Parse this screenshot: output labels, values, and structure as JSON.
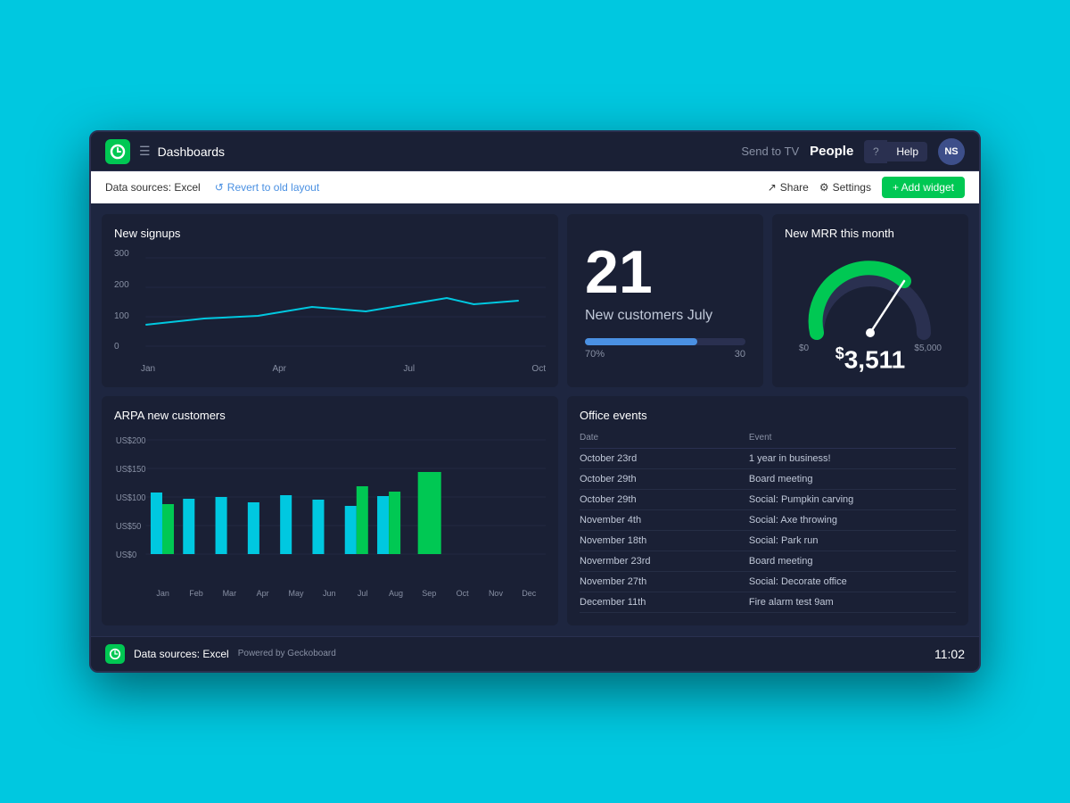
{
  "navbar": {
    "logo_alt": "Geckoboard logo",
    "menu_icon": "☰",
    "title": "Dashboards",
    "send_to_tv": "Send to TV",
    "people": "People",
    "help_q": "?",
    "help_label": "Help",
    "avatar": "NS"
  },
  "subnav": {
    "data_sources": "Data sources: Excel",
    "revert_label": "Revert to old layout",
    "revert_icon": "↺",
    "share_label": "Share",
    "share_icon": "↗",
    "settings_label": "Settings",
    "settings_icon": "⚙",
    "add_widget_label": "+ Add widget"
  },
  "signups_widget": {
    "title": "New signups",
    "y_labels": [
      "300",
      "200",
      "100",
      "0"
    ],
    "x_labels": [
      "Jan",
      "Apr",
      "Jul",
      "Oct"
    ]
  },
  "customers_widget": {
    "number": "21",
    "label": "New customers July",
    "progress_pct": "70%",
    "progress_max": "30"
  },
  "mrr_widget": {
    "title": "New MRR this month",
    "label_left": "$0",
    "label_right": "$5,000",
    "value_prefix": "$",
    "value": "3,511"
  },
  "arpa_widget": {
    "title": "ARPA new customers",
    "y_labels": [
      "US$200",
      "US$150",
      "US$100",
      "US$50",
      "US$0"
    ],
    "x_labels": [
      "Jan",
      "Feb",
      "Mar",
      "Apr",
      "May",
      "Jun",
      "Jul",
      "Aug",
      "Sep",
      "Oct",
      "Nov",
      "Dec"
    ],
    "bars": [
      {
        "month": "Jan",
        "cyan": 110,
        "green": 90
      },
      {
        "month": "Feb",
        "cyan": 95,
        "green": 0
      },
      {
        "month": "Mar",
        "cyan": 100,
        "green": 0
      },
      {
        "month": "Apr",
        "cyan": 90,
        "green": 0
      },
      {
        "month": "May",
        "cyan": 105,
        "green": 0
      },
      {
        "month": "Jun",
        "cyan": 98,
        "green": 0
      },
      {
        "month": "Jul",
        "cyan": 88,
        "green": 120
      },
      {
        "month": "Aug",
        "cyan": 102,
        "green": 110
      },
      {
        "month": "Sep",
        "cyan": 0,
        "green": 145
      },
      {
        "month": "Oct",
        "cyan": 0,
        "green": 0
      },
      {
        "month": "Nov",
        "cyan": 0,
        "green": 0
      },
      {
        "month": "Dec",
        "cyan": 0,
        "green": 0
      }
    ]
  },
  "events_widget": {
    "title": "Office events",
    "col_date": "Date",
    "col_event": "Event",
    "events": [
      {
        "date": "October 23rd",
        "event": "1 year in business!"
      },
      {
        "date": "October 29th",
        "event": "Board meeting"
      },
      {
        "date": "October 29th",
        "event": "Social: Pumpkin carving"
      },
      {
        "date": "November 4th",
        "event": "Social: Axe throwing"
      },
      {
        "date": "November 18th",
        "event": "Social: Park run"
      },
      {
        "date": "Novermber 23rd",
        "event": "Board meeting"
      },
      {
        "date": "November 27th",
        "event": "Social: Decorate office"
      },
      {
        "date": "December 11th",
        "event": "Fire alarm test 9am"
      }
    ]
  },
  "footer": {
    "source": "Data sources: Excel",
    "powered": "Powered by Geckoboard",
    "time": "11:02"
  }
}
